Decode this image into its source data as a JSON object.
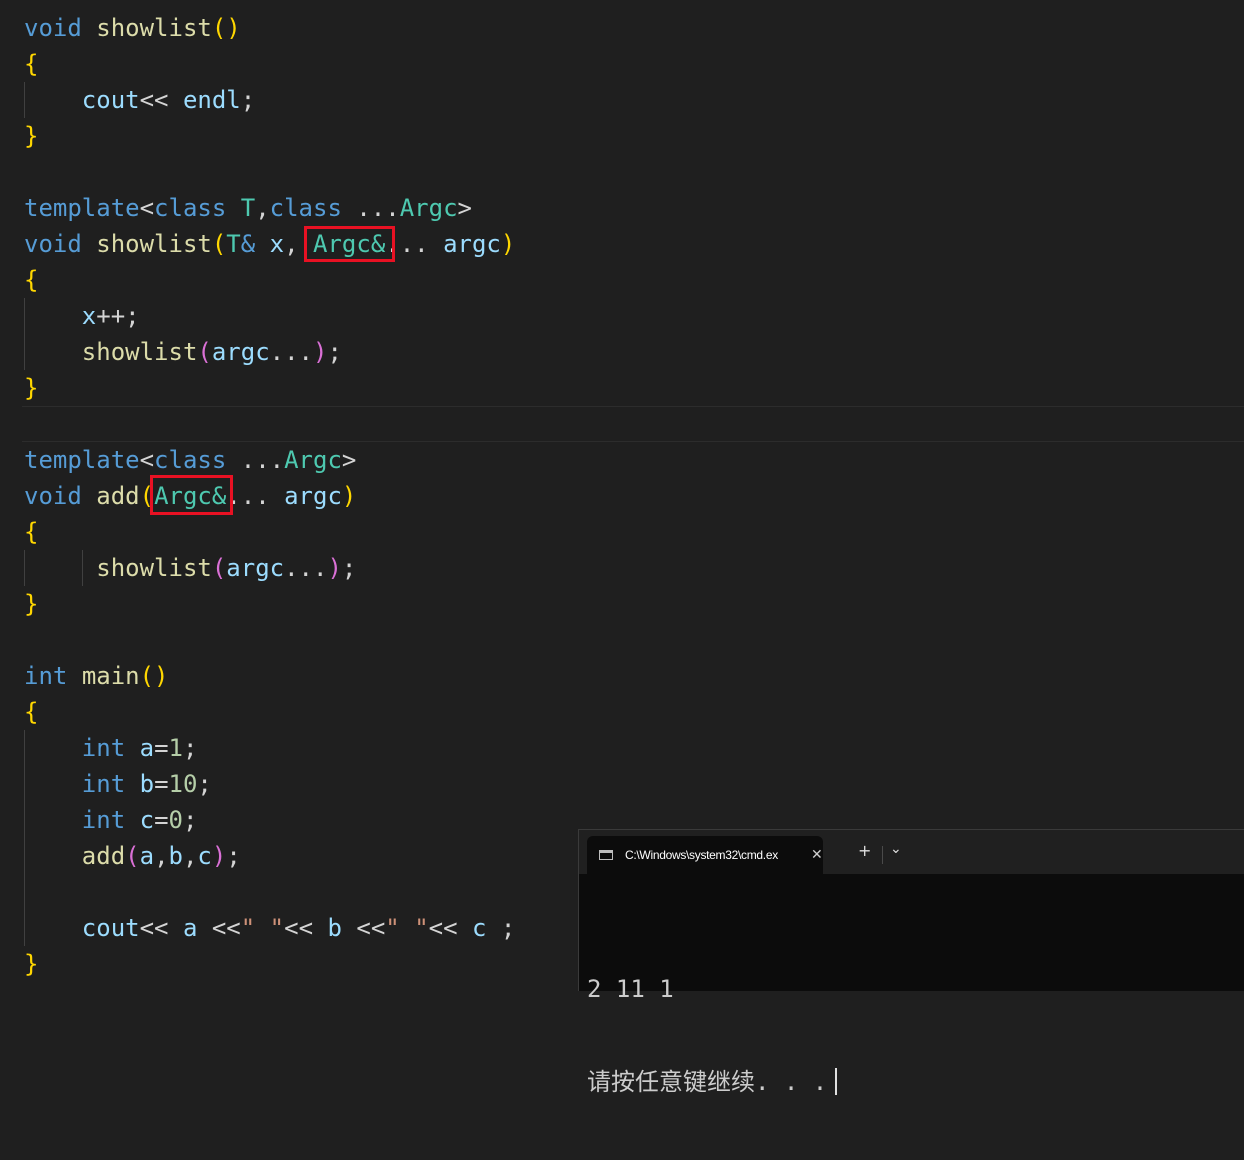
{
  "code": {
    "showlist0": {
      "void": "void",
      "name": "showlist",
      "open": "{",
      "cout": "cout",
      "shift": "<< ",
      "endl": "endl",
      "close": "}"
    },
    "template1": {
      "keyword": "template",
      "class1": "class",
      "T": "T",
      "class2": "class",
      "ellipsis": "...",
      "argc": "Argc"
    },
    "showlist1": {
      "void": "void",
      "name": "showlist",
      "T": "T",
      "amp": "&",
      "x": "x",
      "argc_type": "Argc&",
      "argc": "argc",
      "open": "{",
      "xpp": "x",
      "call": "showlist",
      "call_arg": "argc",
      "close": "}"
    },
    "template2": {
      "keyword": "template",
      "class": "class",
      "ellipsis": "...",
      "argc": "Argc"
    },
    "add": {
      "void": "void",
      "name": "add",
      "argc_type": "Argc&",
      "argc": "argc",
      "open": "{",
      "call": "showlist",
      "call_arg": "argc",
      "close": "}"
    },
    "main": {
      "int": "int",
      "name": "main",
      "open": "{",
      "int_kw": "int",
      "a_var": "a",
      "a_val": "1",
      "b_var": "b",
      "b_val": "10",
      "c_var": "c",
      "c_val": "0",
      "add_call": "add",
      "a": "a",
      "b": "b",
      "c": "c",
      "cout": "cout",
      "space_str": "\" \"",
      "close": "}"
    }
  },
  "terminal": {
    "tab_title": "C:\\Windows\\system32\\cmd.ex",
    "close_glyph": "✕",
    "new_tab_glyph": "+",
    "dropdown_glyph": "⌄",
    "output_line1": "2 11 1",
    "output_line2": "请按任意键继续. . ."
  },
  "colors": {
    "editor_bg": "#1f1f1f",
    "keyword": "#569cd6",
    "function": "#dcdcaa",
    "type": "#4ec9b0",
    "variable": "#9cdcfe",
    "number": "#b5cea8",
    "string": "#ce9178",
    "highlight_box": "#e81123",
    "terminal_bg": "#0c0c0c"
  }
}
